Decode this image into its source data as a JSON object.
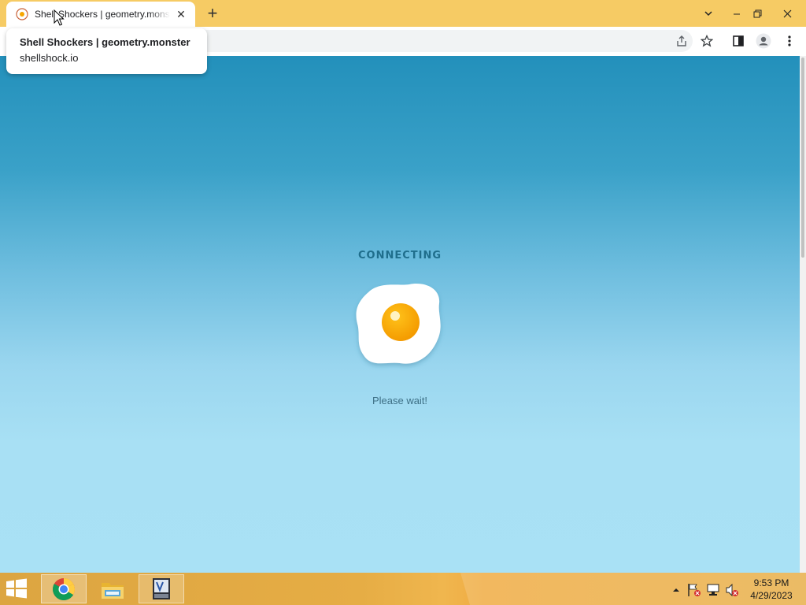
{
  "browser": {
    "tab": {
      "title": "Shell Shockers | geometry.monster",
      "favicon": "egg-favicon-icon",
      "close_symbol": "✕"
    },
    "new_tab_symbol": "+",
    "window_controls": {
      "tab_search": "chevron-down-icon",
      "minimize": "minimize-icon",
      "restore": "restore-icon",
      "close": "close-icon"
    },
    "toolbar_icons": [
      "share-icon",
      "star-icon",
      "side-panel-icon",
      "profile-icon",
      "menu-icon"
    ],
    "tooltip": {
      "title": "Shell Shockers | geometry.monster",
      "url": "shellshock.io"
    }
  },
  "page": {
    "status": "CONNECTING",
    "message": "Please wait!",
    "colors": {
      "bg_top": "#2390bb",
      "bg_bottom": "#a9e1f5",
      "status_text": "#1f6e8c",
      "egg_yolk": "#f7a600"
    }
  },
  "taskbar": {
    "apps": [
      "chrome-icon",
      "file-explorer-icon",
      "text-editor-icon"
    ],
    "tray_icons": [
      "show-hidden-icons-arrow",
      "action-center-flag-icon",
      "network-icon",
      "volume-muted-icon"
    ],
    "clock": {
      "time": "9:53 PM",
      "date": "4/29/2023"
    }
  }
}
